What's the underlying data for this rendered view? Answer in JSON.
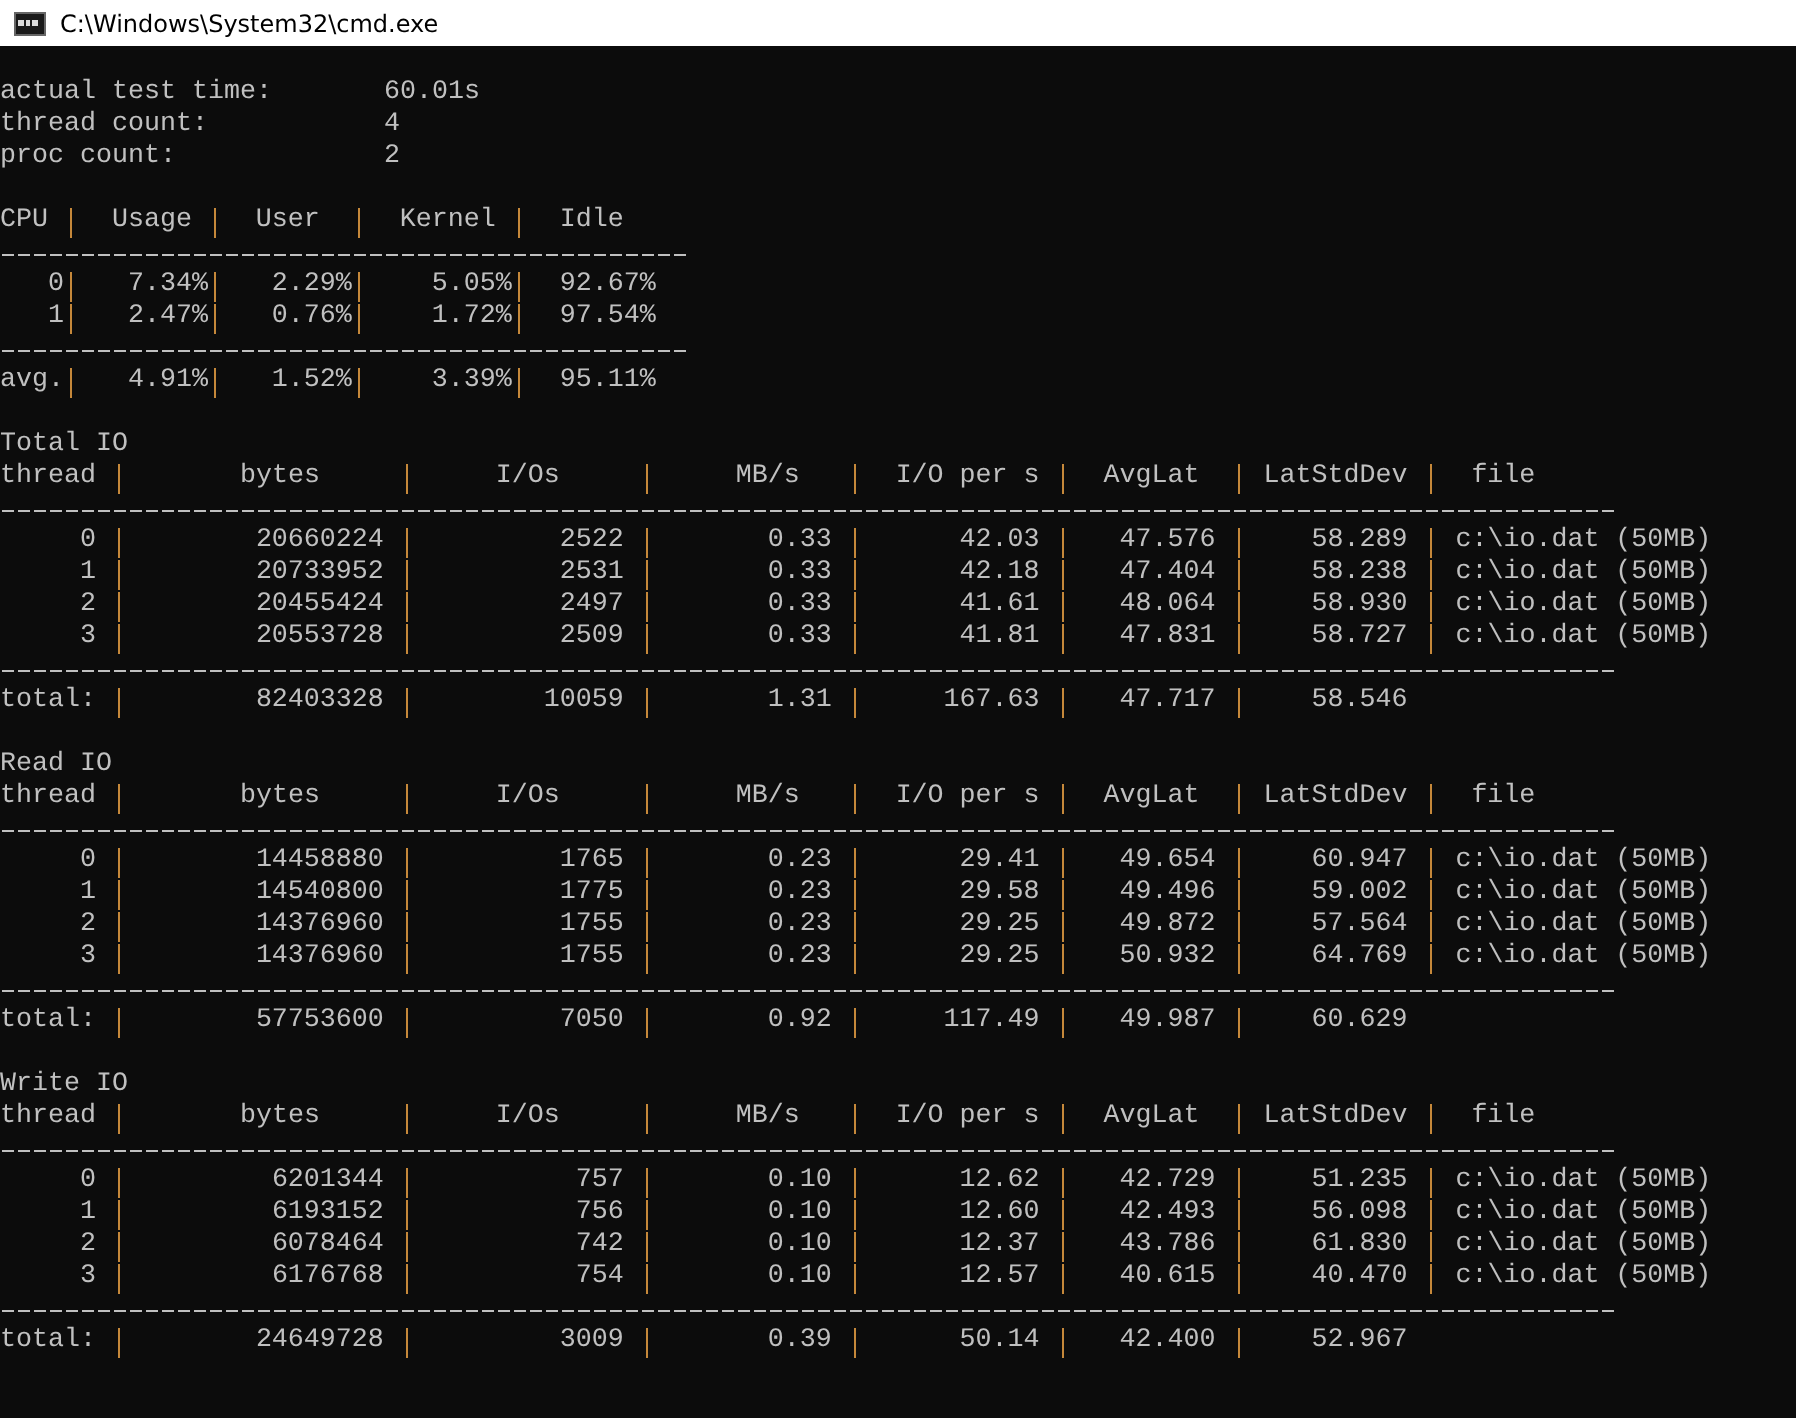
{
  "window": {
    "title": "C:\\Windows\\System32\\cmd.exe"
  },
  "summary": [
    {
      "label": "actual test time:",
      "value": "60.01s"
    },
    {
      "label": "thread count:",
      "value": "4"
    },
    {
      "label": "proc count:",
      "value": "2"
    }
  ],
  "tables": [
    {
      "kind": "cpu",
      "columns": [
        "CPU",
        "Usage",
        "User",
        "Kernel",
        "Idle"
      ],
      "rows": [
        [
          "0",
          "7.34%",
          "2.29%",
          "5.05%",
          "92.67%"
        ],
        [
          "1",
          "2.47%",
          "0.76%",
          "1.72%",
          "97.54%"
        ]
      ],
      "total": [
        "avg.",
        "4.91%",
        "1.52%",
        "3.39%",
        "95.11%"
      ]
    },
    {
      "kind": "io",
      "title": "Total IO",
      "columns": [
        "thread",
        "bytes",
        "I/Os",
        "MB/s",
        "I/O per s",
        "AvgLat",
        "LatStdDev",
        "file"
      ],
      "rows": [
        [
          "0",
          "20660224",
          "2522",
          "0.33",
          "42.03",
          "47.576",
          "58.289",
          "c:\\io.dat (50MB)"
        ],
        [
          "1",
          "20733952",
          "2531",
          "0.33",
          "42.18",
          "47.404",
          "58.238",
          "c:\\io.dat (50MB)"
        ],
        [
          "2",
          "20455424",
          "2497",
          "0.33",
          "41.61",
          "48.064",
          "58.930",
          "c:\\io.dat (50MB)"
        ],
        [
          "3",
          "20553728",
          "2509",
          "0.33",
          "41.81",
          "47.831",
          "58.727",
          "c:\\io.dat (50MB)"
        ]
      ],
      "total": [
        "total:",
        "82403328",
        "10059",
        "1.31",
        "167.63",
        "47.717",
        "58.546"
      ]
    },
    {
      "kind": "io",
      "title": "Read IO",
      "columns": [
        "thread",
        "bytes",
        "I/Os",
        "MB/s",
        "I/O per s",
        "AvgLat",
        "LatStdDev",
        "file"
      ],
      "rows": [
        [
          "0",
          "14458880",
          "1765",
          "0.23",
          "29.41",
          "49.654",
          "60.947",
          "c:\\io.dat (50MB)"
        ],
        [
          "1",
          "14540800",
          "1775",
          "0.23",
          "29.58",
          "49.496",
          "59.002",
          "c:\\io.dat (50MB)"
        ],
        [
          "2",
          "14376960",
          "1755",
          "0.23",
          "29.25",
          "49.872",
          "57.564",
          "c:\\io.dat (50MB)"
        ],
        [
          "3",
          "14376960",
          "1755",
          "0.23",
          "29.25",
          "50.932",
          "64.769",
          "c:\\io.dat (50MB)"
        ]
      ],
      "total": [
        "total:",
        "57753600",
        "7050",
        "0.92",
        "117.49",
        "49.987",
        "60.629"
      ]
    },
    {
      "kind": "io",
      "title": "Write IO",
      "columns": [
        "thread",
        "bytes",
        "I/Os",
        "MB/s",
        "I/O per s",
        "AvgLat",
        "LatStdDev",
        "file"
      ],
      "rows": [
        [
          "0",
          "6201344",
          "757",
          "0.10",
          "12.62",
          "42.729",
          "51.235",
          "c:\\io.dat (50MB)"
        ],
        [
          "1",
          "6193152",
          "756",
          "0.10",
          "12.60",
          "42.493",
          "56.098",
          "c:\\io.dat (50MB)"
        ],
        [
          "2",
          "6078464",
          "742",
          "0.10",
          "12.37",
          "43.786",
          "61.830",
          "c:\\io.dat (50MB)"
        ],
        [
          "3",
          "6176768",
          "754",
          "0.10",
          "12.57",
          "40.615",
          "40.470",
          "c:\\io.dat (50MB)"
        ]
      ],
      "total": [
        "total:",
        "24649728",
        "3009",
        "0.39",
        "50.14",
        "42.400",
        "52.967"
      ]
    }
  ]
}
